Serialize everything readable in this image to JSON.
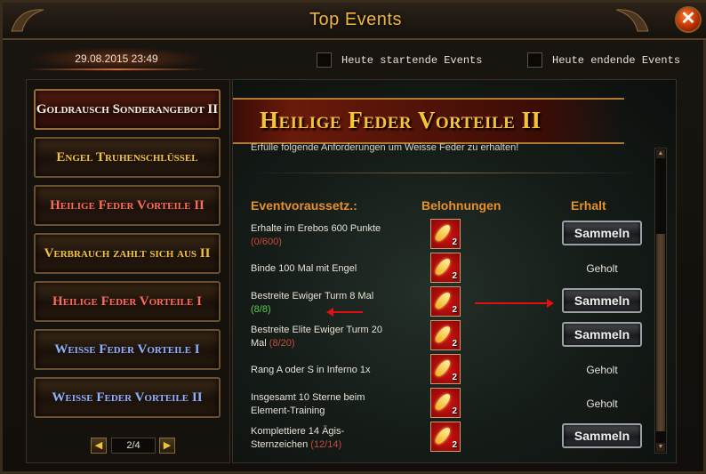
{
  "window": {
    "title": "Top Events",
    "close_glyph": "✕"
  },
  "datetime": "29.08.2015 23:49",
  "filters": [
    {
      "label": "Heute startende Events",
      "checked": false
    },
    {
      "label": "Heute endende Events",
      "checked": false
    }
  ],
  "sidebar": {
    "items": [
      {
        "label": "Goldrausch Sonderangebot II",
        "color": "#f2efe6",
        "active": true
      },
      {
        "label": "Engel Truhenschlüssel",
        "color": "#f2c23a",
        "active": false
      },
      {
        "label": "Heilige Feder Vorteile II",
        "color": "#ff6a5a",
        "active": false
      },
      {
        "label": "Verbrauch zahlt sich aus II",
        "color": "#f2c23a",
        "active": false
      },
      {
        "label": "Heilige Feder Vorteile I",
        "color": "#ff6a5a",
        "active": false
      },
      {
        "label": "Weisse Feder Vorteile I",
        "color": "#8fb0ff",
        "active": false
      },
      {
        "label": "Weisse Feder Vorteile II",
        "color": "#8fb0ff",
        "active": false
      }
    ],
    "pager": {
      "text": "2/4",
      "prev_icon": "arrow-left-icon",
      "next_icon": "arrow-right-icon"
    }
  },
  "event": {
    "title": "Heilige Feder Vorteile II",
    "intro": "Erfülle folgende Anforderungen um Weisse Feder zu erhalten!",
    "headers": {
      "requirement": "Eventvoraussetz.:",
      "rewards": "Belohnungen",
      "receive": "Erhalt"
    },
    "rows": [
      {
        "req": "Erhalte im Erebos 600 Punkte",
        "progress": "(0/600)",
        "done": false,
        "reward_qty": "2",
        "status": "button",
        "action": "Sammeln"
      },
      {
        "req": "Binde 100 Mal mit Engel",
        "progress": "",
        "done": false,
        "reward_qty": "2",
        "status": "text",
        "action": "Geholt"
      },
      {
        "req": "Bestreite Ewiger Turm 8 Mal",
        "progress": "(8/8)",
        "done": true,
        "reward_qty": "2",
        "status": "button",
        "action": "Sammeln"
      },
      {
        "req": "Bestreite Elite Ewiger Turm 20 Mal",
        "progress": "(8/20)",
        "done": false,
        "reward_qty": "2",
        "status": "button",
        "action": "Sammeln"
      },
      {
        "req": "Rang A oder S in Inferno 1x",
        "progress": "",
        "done": false,
        "reward_qty": "2",
        "status": "text",
        "action": "Geholt"
      },
      {
        "req": "Insgesamt 10 Sterne beim Element-Training",
        "progress": "",
        "done": false,
        "reward_qty": "2",
        "status": "text",
        "action": "Geholt"
      },
      {
        "req": "Komplettiere 14 Ägis-Sternzeichen",
        "progress": "(12/14)",
        "done": false,
        "reward_qty": "2",
        "status": "button",
        "action": "Sammeln"
      }
    ],
    "reward_icon": "feather-icon"
  },
  "colors": {
    "accent": "#f0b53d",
    "header": "#e8902a",
    "progress_incomplete": "#c84a3a",
    "progress_done": "#5ccc4a",
    "annotation": "#e01010"
  }
}
